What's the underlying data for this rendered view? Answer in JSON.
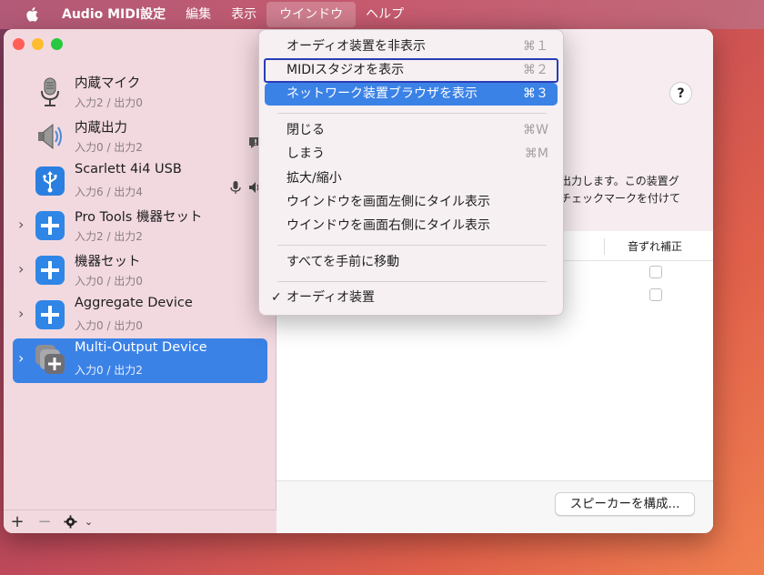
{
  "menubar": {
    "items": [
      "Audio MIDI設定",
      "編集",
      "表示",
      "ウインドウ",
      "ヘルプ"
    ]
  },
  "sidebar": {
    "devices": [
      {
        "name": "内蔵マイク",
        "io": "入力2 / 出力0",
        "icon": "microphone-icon"
      },
      {
        "name": "内蔵出力",
        "io": "入力0 / 出力2",
        "icon": "speaker-icon"
      },
      {
        "name": "Scarlett 4i4 USB",
        "io": "入力6 / 出力4",
        "icon": "usb-icon"
      },
      {
        "name": "Pro Tools 機器セット",
        "io": "入力2 / 出力2",
        "icon": "plus-icon"
      },
      {
        "name": "機器セット",
        "io": "入力0 / 出力0",
        "icon": "plus-icon"
      },
      {
        "name": "Aggregate Device",
        "io": "入力0 / 出力0",
        "icon": "plus-icon"
      },
      {
        "name": "Multi-Output Device",
        "io": "入力0 / 出力2",
        "icon": "multi-output-icon"
      }
    ],
    "toolbar": {
      "add": "+",
      "remove": "−"
    }
  },
  "main": {
    "help": "?",
    "description_line1": "出力します。この装置グ",
    "description_line2": "チェックマークを付けて",
    "column_header": "音ずれ補正",
    "configure_speakers": "スピーカーを構成..."
  },
  "window_menu": {
    "items": [
      {
        "label": "オーディオ装置を非表示",
        "shortcut": "⌘１"
      },
      {
        "label": "MIDIスタジオを表示",
        "shortcut": "⌘２"
      },
      {
        "label": "ネットワーク装置ブラウザを表示",
        "shortcut": "⌘３"
      },
      {
        "label": "閉じる",
        "shortcut": "⌘W"
      },
      {
        "label": "しまう",
        "shortcut": "⌘M"
      },
      {
        "label": "拡大/縮小",
        "shortcut": ""
      },
      {
        "label": "ウインドウを画面左側にタイル表示",
        "shortcut": ""
      },
      {
        "label": "ウインドウを画面右側にタイル表示",
        "shortcut": ""
      },
      {
        "label": "すべてを手前に移動",
        "shortcut": ""
      },
      {
        "label": "オーディオ装置",
        "shortcut": "",
        "check": "✓"
      }
    ]
  },
  "colors": {
    "accent": "#3b82e6",
    "focus_box": "#2b3db5"
  }
}
